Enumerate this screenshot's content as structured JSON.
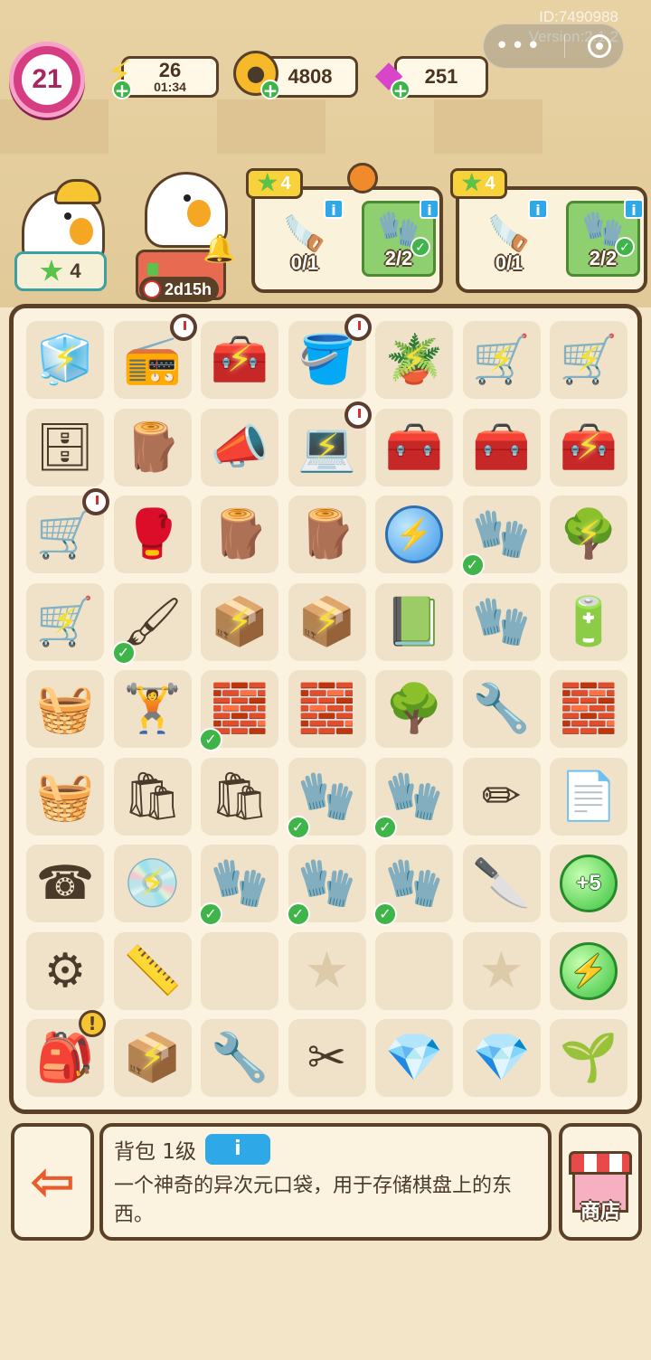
{
  "overlay": {
    "user_id": "ID:7490988",
    "version": "Version:2.1.2"
  },
  "header": {
    "level": "21",
    "energy": {
      "value": "26",
      "timer": "01:34"
    },
    "coins": {
      "value": "4808"
    },
    "gems": {
      "value": "251"
    }
  },
  "characters": {
    "worker_stars": "4",
    "cook_timer": "2d15h"
  },
  "orders": [
    {
      "stars": "4",
      "items": [
        {
          "icon": "saw-icon",
          "count": "0/1",
          "done": false
        },
        {
          "icon": "glove-icon",
          "count": "2/2",
          "done": true
        }
      ]
    },
    {
      "stars": "4",
      "items": [
        {
          "icon": "saw-icon",
          "count": "0/1",
          "done": false
        },
        {
          "icon": "glove-icon",
          "count": "2/2",
          "done": true
        }
      ]
    }
  ],
  "board": {
    "rows": [
      [
        {
          "icon": "ice-block-icon",
          "glyph": "🧊",
          "charged": true
        },
        {
          "icon": "radio-icon",
          "glyph": "📻",
          "timer": true
        },
        {
          "icon": "tool-box-icon",
          "glyph": "🧰",
          "charged": true
        },
        {
          "icon": "bucket-tools-icon",
          "glyph": "🪣",
          "timer": true
        },
        {
          "icon": "pot-icon",
          "glyph": "🪴",
          "charged": true
        },
        {
          "icon": "cart-icon",
          "glyph": "🛒",
          "charged": true
        },
        {
          "icon": "cart-full-icon",
          "glyph": "🛒",
          "charged": true
        }
      ],
      [
        {
          "icon": "cabinet-icon",
          "glyph": "🗄"
        },
        {
          "icon": "stump-icon",
          "glyph": "🪵"
        },
        {
          "icon": "megaphone-icon",
          "glyph": "📣"
        },
        {
          "icon": "laptop-icon",
          "glyph": "💻",
          "timer": true,
          "charged": true
        },
        {
          "icon": "toolbox-green-icon",
          "glyph": "🧰"
        },
        {
          "icon": "toolbox-green-icon",
          "glyph": "🧰"
        },
        {
          "icon": "toolbox-open-icon",
          "glyph": "🧰",
          "charged": true
        }
      ],
      [
        {
          "icon": "cart-tools-icon",
          "glyph": "🛒",
          "timer": true
        },
        {
          "icon": "boxing-glove-icon",
          "glyph": "🥊"
        },
        {
          "icon": "broken-stump-icon",
          "glyph": "🪵"
        },
        {
          "icon": "wood-chunk-icon",
          "glyph": "🪵"
        },
        {
          "icon": "energy-bubble-icon",
          "bubble": "blue"
        },
        {
          "icon": "glove-icon",
          "glyph": "🧤",
          "check": true
        },
        {
          "icon": "shrub-icon",
          "glyph": "🌳",
          "charged": true
        }
      ],
      [
        {
          "icon": "cart-weights-icon",
          "glyph": "🛒",
          "charged": true
        },
        {
          "icon": "paint-roller-icon",
          "glyph": "🖌",
          "check": true
        },
        {
          "icon": "box-charged-icon",
          "glyph": "📦",
          "charged": true
        },
        {
          "icon": "box-charged-icon",
          "glyph": "📦",
          "charged": true
        },
        {
          "icon": "book-icon",
          "glyph": "📗"
        },
        {
          "icon": "glove-icon",
          "glyph": "🧤"
        },
        {
          "icon": "chips-icon",
          "glyph": "🔋"
        }
      ],
      [
        {
          "icon": "basket-shovel-icon",
          "glyph": "🧺"
        },
        {
          "icon": "dumbbell-icon",
          "glyph": "🏋"
        },
        {
          "icon": "bricks-icon",
          "glyph": "🧱",
          "check": true
        },
        {
          "icon": "bricks-icon",
          "glyph": "🧱"
        },
        {
          "icon": "potted-tree-icon",
          "glyph": "🌳"
        },
        {
          "icon": "pipe-icon",
          "glyph": "🔧"
        },
        {
          "icon": "brick-icon",
          "glyph": "🧱"
        }
      ],
      [
        {
          "icon": "basket-gear-icon",
          "glyph": "🧺"
        },
        {
          "icon": "sandbag-stack-icon",
          "glyph": "🛍"
        },
        {
          "icon": "sandbag-icon",
          "glyph": "🛍"
        },
        {
          "icon": "glove-icon",
          "glyph": "🧤",
          "check": true
        },
        {
          "icon": "glove-icon",
          "glyph": "🧤",
          "check": true
        },
        {
          "icon": "pencil-icon",
          "glyph": "✏"
        },
        {
          "icon": "seed-packet-icon",
          "glyph": "📄"
        }
      ],
      [
        {
          "icon": "phone-icon",
          "glyph": "☎"
        },
        {
          "icon": "robot-vacuum-icon",
          "glyph": "💿",
          "charged": true
        },
        {
          "icon": "glove-icon",
          "glyph": "🧤",
          "check": true
        },
        {
          "icon": "glove-icon",
          "glyph": "🧤",
          "check": true
        },
        {
          "icon": "glove-icon",
          "glyph": "🧤",
          "check": true
        },
        {
          "icon": "cutter-icon",
          "glyph": "🔪"
        },
        {
          "icon": "bonus-bubble-icon",
          "bubble": "green",
          "text": "+5"
        }
      ],
      [
        {
          "icon": "ab-wheel-icon",
          "glyph": "⚙"
        },
        {
          "icon": "tape-measure-icon",
          "glyph": "📏"
        },
        {
          "icon": "empty-slot",
          "empty": true
        },
        {
          "icon": "locked-star-icon",
          "star": true
        },
        {
          "icon": "empty-slot",
          "empty": true
        },
        {
          "icon": "locked-star-icon",
          "star": true
        },
        {
          "icon": "energy-bubble-icon",
          "bubble": "green"
        }
      ],
      [
        {
          "icon": "backpack-icon",
          "glyph": "🎒",
          "excl": true
        },
        {
          "icon": "box-tools-icon",
          "glyph": "📦",
          "charged": true
        },
        {
          "icon": "wrench-icon",
          "glyph": "🔧"
        },
        {
          "icon": "pliers-icon",
          "glyph": "✂"
        },
        {
          "icon": "gem-icon",
          "glyph": "💎"
        },
        {
          "icon": "gems-icon",
          "glyph": "💎"
        },
        {
          "icon": "sapling-icon",
          "glyph": "🌱"
        }
      ]
    ]
  },
  "info_panel": {
    "title": "背包 1级",
    "description": "一个神奇的异次元口袋，用于存储棋盘上的东西。",
    "info_button": "i"
  },
  "shop_button": {
    "label": "商店"
  },
  "colors": {
    "accent": "#5b4028",
    "board_bg": "#fbf2df",
    "check": "#3fb448"
  }
}
